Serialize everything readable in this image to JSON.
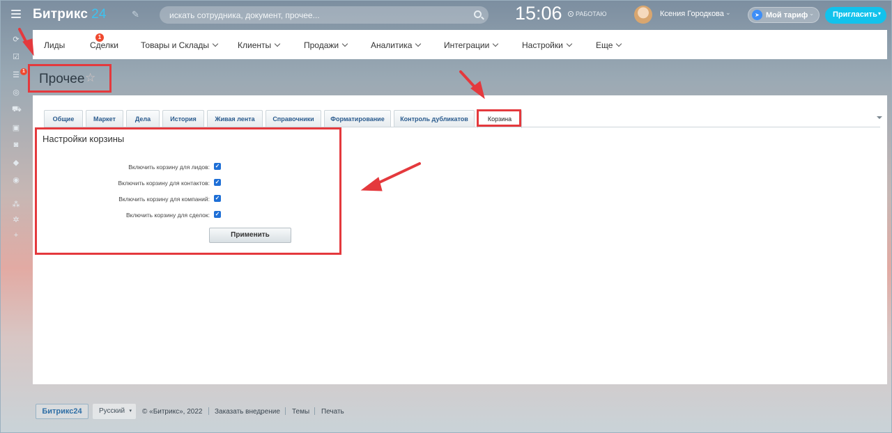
{
  "header": {
    "logo_text": "Битрикс",
    "logo_number": "24",
    "search_placeholder": "искать сотрудника, документ, прочее...",
    "clock": "15:06",
    "work_status": "РАБОТАЮ",
    "user_name": "Ксения Городкова",
    "tariff_label": "Мой тариф",
    "invite_label": "Пригласить"
  },
  "sidebar": {
    "badge": "1",
    "icons": [
      "recent-icon",
      "tasks-icon",
      "crm-icon",
      "target-icon",
      "cart-icon",
      "contact-card-icon",
      "robot-icon",
      "box-icon",
      "chevron-circle-icon",
      "sitemap-icon",
      "gear-icon",
      "plus-icon"
    ]
  },
  "nav": {
    "items": [
      {
        "label": "Лиды",
        "badge": "1"
      },
      {
        "label": "Сделки"
      },
      {
        "label": "Товары и Склады"
      },
      {
        "label": "Клиенты"
      },
      {
        "label": "Продажи"
      },
      {
        "label": "Аналитика"
      },
      {
        "label": "Интеграции"
      },
      {
        "label": "Настройки"
      },
      {
        "label": "Еще"
      }
    ]
  },
  "page": {
    "title": "Прочее"
  },
  "tabs": [
    {
      "label": "Общие"
    },
    {
      "label": "Маркет"
    },
    {
      "label": "Дела"
    },
    {
      "label": "История"
    },
    {
      "label": "Живая лента"
    },
    {
      "label": "Справочники"
    },
    {
      "label": "Форматирование"
    },
    {
      "label": "Контроль дубликатов"
    },
    {
      "label": "Корзина",
      "active": true
    }
  ],
  "settings": {
    "title": "Настройки корзины",
    "rows": [
      {
        "label": "Включить корзину для лидов:",
        "checked": true
      },
      {
        "label": "Включить корзину для контактов:",
        "checked": true
      },
      {
        "label": "Включить корзину для компаний:",
        "checked": true
      },
      {
        "label": "Включить корзину для сделок:",
        "checked": true
      }
    ],
    "apply_label": "Применить"
  },
  "footer": {
    "logo": "Битрикс24",
    "language": "Русский",
    "copyright": "© «Битрикс», 2022",
    "order": "Заказать внедрение",
    "themes": "Темы",
    "print": "Печать"
  },
  "colors": {
    "accent": "#12c2ec",
    "annotation": "#e4393d",
    "checkbox": "#1e6fd6"
  }
}
